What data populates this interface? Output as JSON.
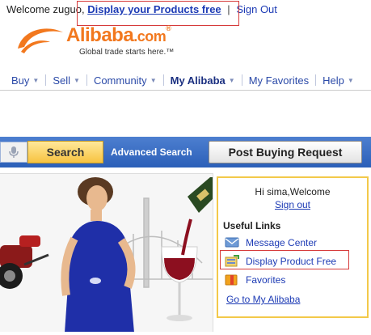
{
  "top": {
    "welcome_prefix": "Welcome zuguo,",
    "display_link": "Display your Products free",
    "separator": "|",
    "sign_out": "Sign Out"
  },
  "logo": {
    "word": "Alibaba",
    "dotcom": ".com",
    "registered": "®",
    "tagline": "Global trade starts here.™",
    "brand_color": "#f2781e"
  },
  "nav": {
    "items": [
      {
        "label": "Buy"
      },
      {
        "label": "Sell"
      },
      {
        "label": "Community"
      },
      {
        "label": "My Alibaba"
      },
      {
        "label": "My Favorites"
      },
      {
        "label": "Help"
      }
    ]
  },
  "search": {
    "button": "Search",
    "advanced": "Advanced Search",
    "post_request": "Post Buying Request",
    "bar_color": "#3566c0"
  },
  "panel": {
    "greeting": "Hi sima,Welcome",
    "sign_out": "Sign out",
    "useful_links_title": "Useful Links",
    "links": [
      {
        "label": "Message Center",
        "icon": "envelope-icon"
      },
      {
        "label": "Display Product Free",
        "icon": "display-product-icon"
      },
      {
        "label": "Favorites",
        "icon": "favorites-icon"
      }
    ],
    "goto": "Go to My Alibaba",
    "border_color": "#f3c94a"
  },
  "highlight_color": "#d63a3a"
}
